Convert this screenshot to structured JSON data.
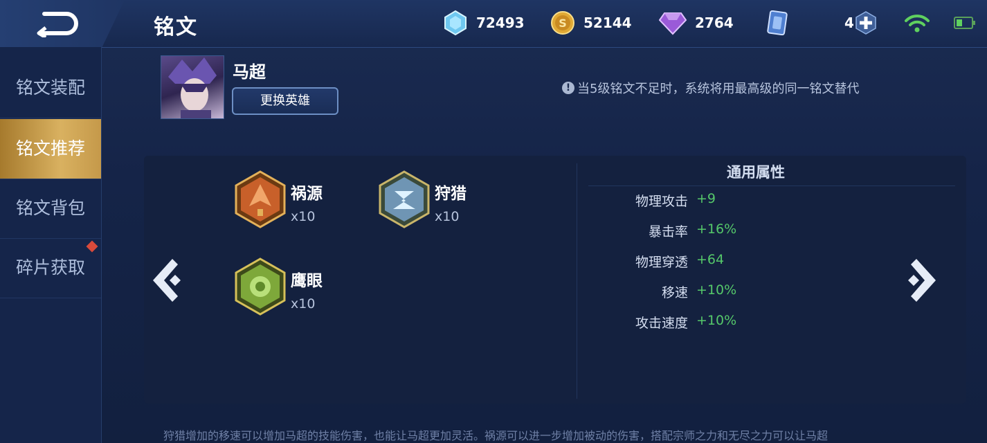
{
  "header": {
    "title": "铭文",
    "resources": [
      {
        "icon": "ice-crystal-icon",
        "value": "72493"
      },
      {
        "icon": "gold-coin-icon",
        "value": "52144"
      },
      {
        "icon": "purple-diamond-icon",
        "value": "2764"
      },
      {
        "icon": "rune-card-icon",
        "value": "4"
      }
    ],
    "battery_level": 0.4
  },
  "sidebar": {
    "items": [
      {
        "label": "铭文装配",
        "active": false
      },
      {
        "label": "铭文推荐",
        "active": true
      },
      {
        "label": "铭文背包",
        "active": false
      },
      {
        "label": "碎片获取",
        "active": false
      }
    ]
  },
  "hero": {
    "name": "马超",
    "change_label": "更换英雄"
  },
  "notice": "当5级铭文不足时，系统将用最高级的同一铭文替代",
  "runes": [
    {
      "name": "祸源",
      "count": "x10",
      "color": "#c8602a"
    },
    {
      "name": "狩猎",
      "count": "x10",
      "color": "#8fb0c8"
    },
    {
      "name": "鹰眼",
      "count": "x10",
      "color": "#8fbf3f"
    }
  ],
  "attributes": {
    "title": "通用属性",
    "rows": [
      {
        "label": "物理攻击",
        "value": "+9"
      },
      {
        "label": "暴击率",
        "value": "+16%"
      },
      {
        "label": "物理穿透",
        "value": "+64"
      },
      {
        "label": "移速",
        "value": "+10%"
      },
      {
        "label": "攻击速度",
        "value": "+10%"
      }
    ]
  },
  "footer": "狩猎增加的移速可以增加马超的技能伤害，也能让马超更加灵活。祸源可以进一步增加被动的伤害，搭配宗师之力和无尽之力可以让马超"
}
